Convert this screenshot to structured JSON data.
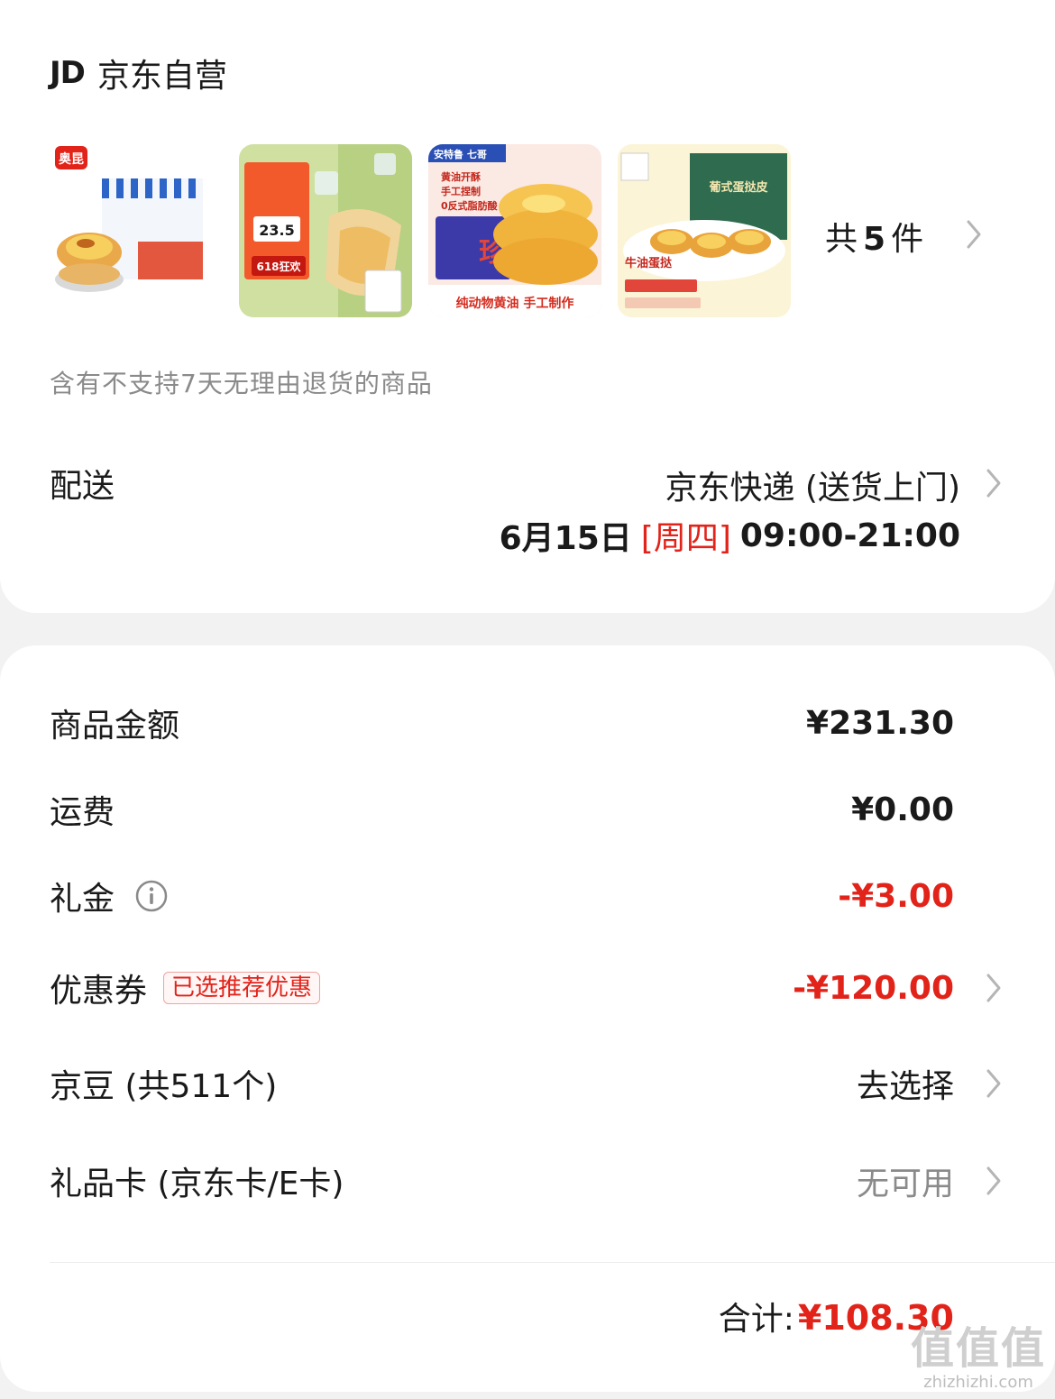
{
  "store": {
    "logo": "JD",
    "name": "京东自营",
    "thumbnails": [
      {
        "icon": "product-egg-tart-box-image",
        "brand": "奥昆"
      },
      {
        "icon": "product-egg-tart-green-image",
        "tag": "23.5",
        "badge": "618狂欢"
      },
      {
        "icon": "product-egg-tart-pastry-image",
        "brand": "安特鲁 七哥",
        "lines": [
          "黄油开酥",
          "手工捏制",
          "0反式脂肪酸"
        ],
        "big": "珍馔",
        "footer": "纯动物黄油 手工制作"
      },
      {
        "icon": "product-portuguese-tart-image",
        "title": "葡式蛋挞皮",
        "caption": "牛油蛋挞"
      }
    ],
    "count_prefix": "共",
    "count_value": "5",
    "count_suffix": "件",
    "notice": "含有不支持7天无理由退货的商品"
  },
  "shipping": {
    "label": "配送",
    "method": "京东快递 (送货上门)",
    "date": "6月15日",
    "weekday": "[周四]",
    "hours": "09:00-21:00"
  },
  "summary": {
    "rows": [
      {
        "label": "商品金额",
        "value": "¥231.30"
      },
      {
        "label": "运费",
        "value": "¥0.00"
      },
      {
        "label": "礼金",
        "value": "-¥3.00"
      },
      {
        "label": "优惠券",
        "badge": "已选推荐优惠",
        "value": "-¥120.00"
      },
      {
        "label": "京豆 (共511个)",
        "value": "去选择"
      },
      {
        "label": "礼品卡 (京东卡/E卡)",
        "value": "无可用"
      }
    ],
    "total_label": "合计:",
    "total_value": "¥108.30"
  },
  "watermark": {
    "mark": "值值值",
    "url": "zhizhizhi.com"
  },
  "colors": {
    "accent_red": "#e2231a",
    "muted_gray": "#8a8a8a",
    "background": "#f2f2f2"
  }
}
